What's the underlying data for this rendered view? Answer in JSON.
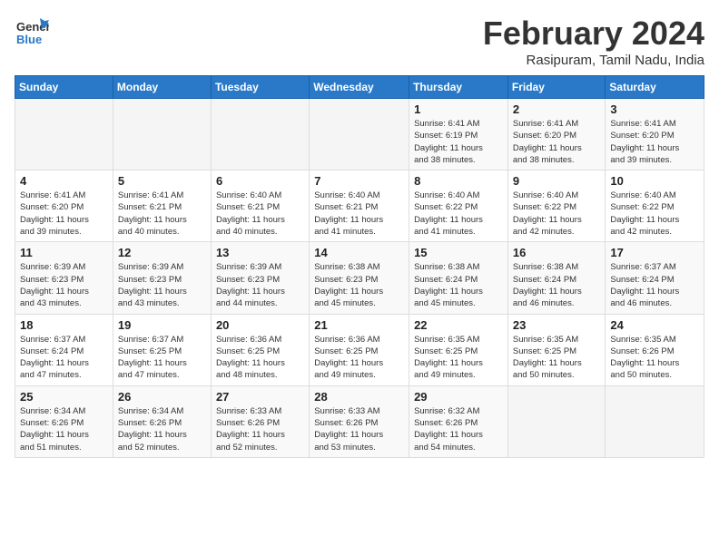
{
  "header": {
    "logo_general": "General",
    "logo_blue": "Blue",
    "title": "February 2024",
    "subtitle": "Rasipuram, Tamil Nadu, India"
  },
  "weekdays": [
    "Sunday",
    "Monday",
    "Tuesday",
    "Wednesday",
    "Thursday",
    "Friday",
    "Saturday"
  ],
  "weeks": [
    [
      {
        "day": "",
        "info": ""
      },
      {
        "day": "",
        "info": ""
      },
      {
        "day": "",
        "info": ""
      },
      {
        "day": "",
        "info": ""
      },
      {
        "day": "1",
        "info": "Sunrise: 6:41 AM\nSunset: 6:19 PM\nDaylight: 11 hours\nand 38 minutes."
      },
      {
        "day": "2",
        "info": "Sunrise: 6:41 AM\nSunset: 6:20 PM\nDaylight: 11 hours\nand 38 minutes."
      },
      {
        "day": "3",
        "info": "Sunrise: 6:41 AM\nSunset: 6:20 PM\nDaylight: 11 hours\nand 39 minutes."
      }
    ],
    [
      {
        "day": "4",
        "info": "Sunrise: 6:41 AM\nSunset: 6:20 PM\nDaylight: 11 hours\nand 39 minutes."
      },
      {
        "day": "5",
        "info": "Sunrise: 6:41 AM\nSunset: 6:21 PM\nDaylight: 11 hours\nand 40 minutes."
      },
      {
        "day": "6",
        "info": "Sunrise: 6:40 AM\nSunset: 6:21 PM\nDaylight: 11 hours\nand 40 minutes."
      },
      {
        "day": "7",
        "info": "Sunrise: 6:40 AM\nSunset: 6:21 PM\nDaylight: 11 hours\nand 41 minutes."
      },
      {
        "day": "8",
        "info": "Sunrise: 6:40 AM\nSunset: 6:22 PM\nDaylight: 11 hours\nand 41 minutes."
      },
      {
        "day": "9",
        "info": "Sunrise: 6:40 AM\nSunset: 6:22 PM\nDaylight: 11 hours\nand 42 minutes."
      },
      {
        "day": "10",
        "info": "Sunrise: 6:40 AM\nSunset: 6:22 PM\nDaylight: 11 hours\nand 42 minutes."
      }
    ],
    [
      {
        "day": "11",
        "info": "Sunrise: 6:39 AM\nSunset: 6:23 PM\nDaylight: 11 hours\nand 43 minutes."
      },
      {
        "day": "12",
        "info": "Sunrise: 6:39 AM\nSunset: 6:23 PM\nDaylight: 11 hours\nand 43 minutes."
      },
      {
        "day": "13",
        "info": "Sunrise: 6:39 AM\nSunset: 6:23 PM\nDaylight: 11 hours\nand 44 minutes."
      },
      {
        "day": "14",
        "info": "Sunrise: 6:38 AM\nSunset: 6:23 PM\nDaylight: 11 hours\nand 45 minutes."
      },
      {
        "day": "15",
        "info": "Sunrise: 6:38 AM\nSunset: 6:24 PM\nDaylight: 11 hours\nand 45 minutes."
      },
      {
        "day": "16",
        "info": "Sunrise: 6:38 AM\nSunset: 6:24 PM\nDaylight: 11 hours\nand 46 minutes."
      },
      {
        "day": "17",
        "info": "Sunrise: 6:37 AM\nSunset: 6:24 PM\nDaylight: 11 hours\nand 46 minutes."
      }
    ],
    [
      {
        "day": "18",
        "info": "Sunrise: 6:37 AM\nSunset: 6:24 PM\nDaylight: 11 hours\nand 47 minutes."
      },
      {
        "day": "19",
        "info": "Sunrise: 6:37 AM\nSunset: 6:25 PM\nDaylight: 11 hours\nand 47 minutes."
      },
      {
        "day": "20",
        "info": "Sunrise: 6:36 AM\nSunset: 6:25 PM\nDaylight: 11 hours\nand 48 minutes."
      },
      {
        "day": "21",
        "info": "Sunrise: 6:36 AM\nSunset: 6:25 PM\nDaylight: 11 hours\nand 49 minutes."
      },
      {
        "day": "22",
        "info": "Sunrise: 6:35 AM\nSunset: 6:25 PM\nDaylight: 11 hours\nand 49 minutes."
      },
      {
        "day": "23",
        "info": "Sunrise: 6:35 AM\nSunset: 6:25 PM\nDaylight: 11 hours\nand 50 minutes."
      },
      {
        "day": "24",
        "info": "Sunrise: 6:35 AM\nSunset: 6:26 PM\nDaylight: 11 hours\nand 50 minutes."
      }
    ],
    [
      {
        "day": "25",
        "info": "Sunrise: 6:34 AM\nSunset: 6:26 PM\nDaylight: 11 hours\nand 51 minutes."
      },
      {
        "day": "26",
        "info": "Sunrise: 6:34 AM\nSunset: 6:26 PM\nDaylight: 11 hours\nand 52 minutes."
      },
      {
        "day": "27",
        "info": "Sunrise: 6:33 AM\nSunset: 6:26 PM\nDaylight: 11 hours\nand 52 minutes."
      },
      {
        "day": "28",
        "info": "Sunrise: 6:33 AM\nSunset: 6:26 PM\nDaylight: 11 hours\nand 53 minutes."
      },
      {
        "day": "29",
        "info": "Sunrise: 6:32 AM\nSunset: 6:26 PM\nDaylight: 11 hours\nand 54 minutes."
      },
      {
        "day": "",
        "info": ""
      },
      {
        "day": "",
        "info": ""
      }
    ]
  ]
}
